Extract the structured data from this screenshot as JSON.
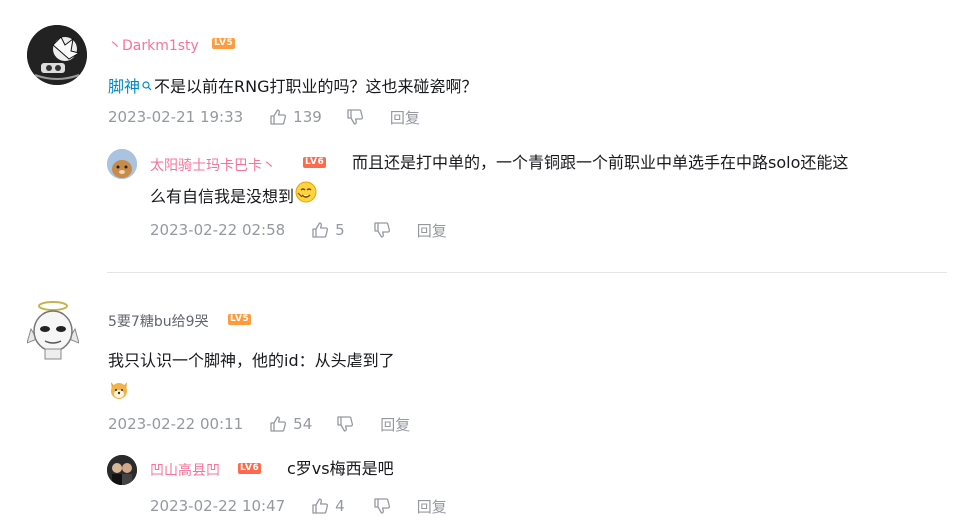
{
  "comments": [
    {
      "username": "Darkm1sty",
      "username_prefix": "丶",
      "level": "LV5",
      "mention": "脚神",
      "text": "不是以前在RNG打职业的吗？这也来碰瓷啊？",
      "time": "2023-02-21 19:33",
      "likes": "139",
      "reply_label": "回复",
      "replies": [
        {
          "username": "太阳骑士玛卡巴卡丶",
          "level": "LV6",
          "text_line1": "而且还是打中单的，一个青铜跟一个前职业中单选手在中路solo还能这",
          "text_line2": "么有自信我是没想到",
          "time": "2023-02-22 02:58",
          "likes": "5",
          "reply_label": "回复"
        }
      ]
    },
    {
      "username": "5要7糖bu给9哭",
      "level": "LV5",
      "text": "我只认识一个脚神，他的id：从头虐到了",
      "time": "2023-02-22 00:11",
      "likes": "54",
      "reply_label": "回复",
      "replies": [
        {
          "username": "凹山高县凹",
          "level": "LV6",
          "text": "c罗vs梅西是吧",
          "time": "2023-02-22 10:47",
          "likes": "4",
          "reply_label": "回复"
        }
      ]
    }
  ],
  "colors": {
    "vip_name": "#fb7299",
    "normal_name": "#61666d",
    "link": "#008ac5",
    "lv5": "#ff9b3d",
    "lv6": "#ff6a4d",
    "meta": "#9499a0"
  },
  "icons": [
    "like-icon",
    "dislike-icon",
    "search-icon",
    "emoji-icon"
  ]
}
